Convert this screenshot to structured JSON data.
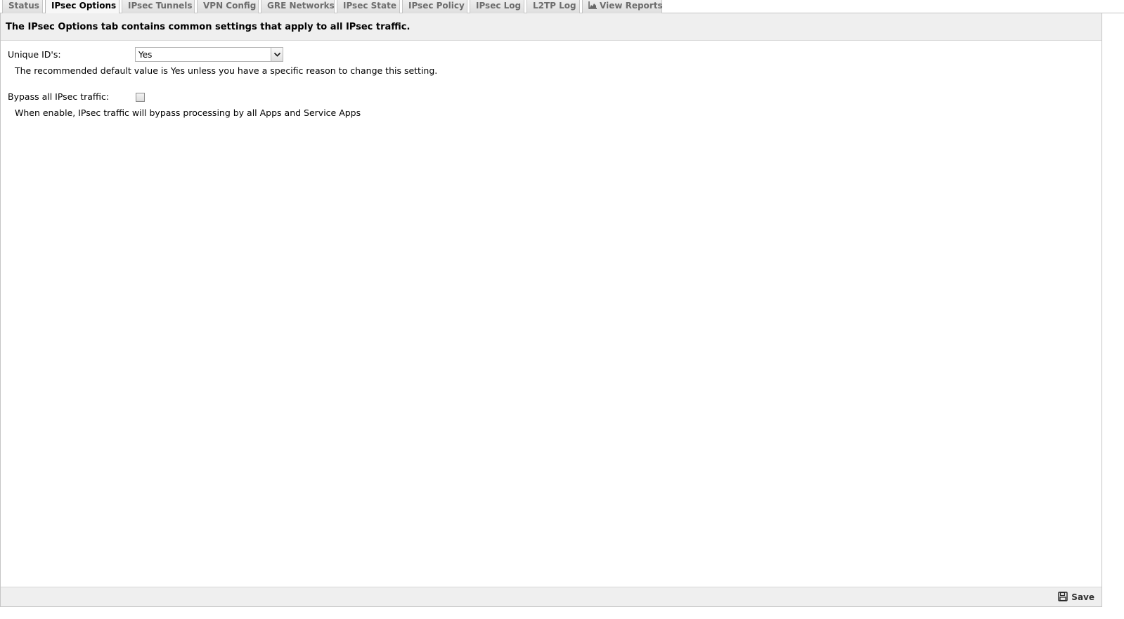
{
  "tabs": [
    {
      "label": "Status",
      "active": false
    },
    {
      "label": "IPsec Options",
      "active": true
    },
    {
      "label": "IPsec Tunnels",
      "active": false
    },
    {
      "label": "VPN Config",
      "active": false
    },
    {
      "label": "GRE Networks",
      "active": false
    },
    {
      "label": "IPsec State",
      "active": false
    },
    {
      "label": "IPsec Policy",
      "active": false
    },
    {
      "label": "IPsec Log",
      "active": false
    },
    {
      "label": "L2TP Log",
      "active": false
    },
    {
      "label": "View Reports",
      "active": false,
      "icon": "chart-icon"
    }
  ],
  "panel": {
    "description": "The IPsec Options tab contains common settings that apply to all IPsec traffic.",
    "unique_ids": {
      "label": "Unique ID's:",
      "value": "Yes",
      "hint": "The recommended default value is Yes unless you have a specific reason to change this setting."
    },
    "bypass": {
      "label": "Bypass all IPsec traffic:",
      "checked": false,
      "hint": "When enable, IPsec traffic will bypass processing by all Apps and Service Apps"
    }
  },
  "footer": {
    "save_label": "Save",
    "save_icon": "floppy-disk-icon"
  }
}
